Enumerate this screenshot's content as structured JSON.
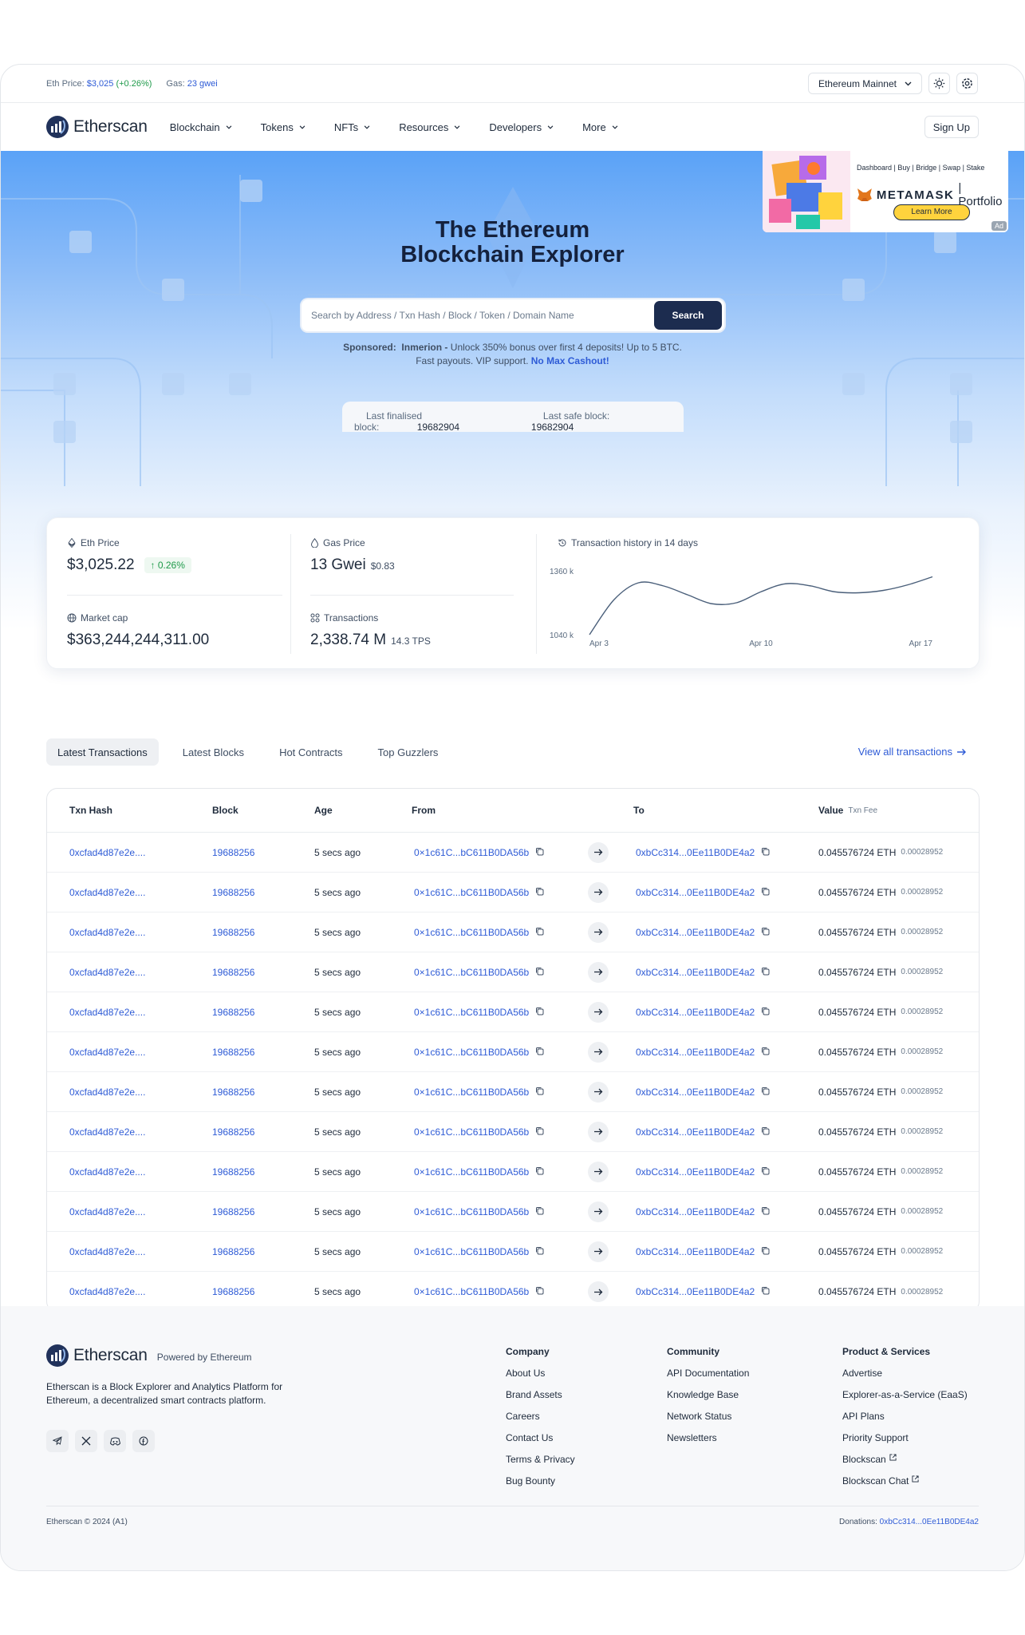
{
  "topbar": {
    "eth_price_label": "Eth Price:",
    "eth_price_value": "$3,025",
    "eth_price_change": "(+0.26%)",
    "gas_label": "Gas:",
    "gas_value": "23 gwei",
    "network": "Ethereum Mainnet"
  },
  "nav": {
    "logo": "Etherscan",
    "items": [
      "Blockchain",
      "Tokens",
      "NFTs",
      "Resources",
      "Developers",
      "More"
    ],
    "signup": "Sign Up"
  },
  "hero": {
    "title_line1": "The Ethereum",
    "title_line2": "Blockchain Explorer",
    "search_placeholder": "Search by Address / Txn Hash / Block / Token / Domain Name",
    "search_button": "Search",
    "sponsored_label": "Sponsored:",
    "sponsor_name": "Inmerion -",
    "sponsor_text1": " Unlock 350% bonus over first 4 deposits! Up to 5 BTC.",
    "sponsor_text2": "Fast payouts. VIP support. ",
    "sponsor_link": "No Max Cashout!"
  },
  "ad": {
    "menu": "Dashboard | Buy | Bridge | Swap | Stake",
    "brand": "METAMASK",
    "brand2": "| Portfolio",
    "button": "Learn More",
    "tag": "Ad"
  },
  "finality": {
    "finalised_label": "Last finalised block:",
    "finalised_value": "19682904",
    "safe_label": "Last safe block:",
    "safe_value": "19682904"
  },
  "stats": {
    "eth_price_label": "Eth Price",
    "eth_price_value": "$3,025.22",
    "eth_price_change": "0.26%",
    "market_cap_label": "Market cap",
    "market_cap_value": "$363,244,244,311.00",
    "gas_label": "Gas Price",
    "gas_value": "13 Gwei",
    "gas_usd": "$0.83",
    "tx_label": "Transactions",
    "tx_value": "2,338.74 M",
    "tx_tps": "14.3 TPS",
    "history_label": "Transaction history in 14 days"
  },
  "chart_data": {
    "type": "line",
    "x": [
      "Apr 3",
      "Apr 4",
      "Apr 5",
      "Apr 6",
      "Apr 7",
      "Apr 8",
      "Apr 9",
      "Apr 10",
      "Apr 11",
      "Apr 12",
      "Apr 13",
      "Apr 14",
      "Apr 15",
      "Apr 16",
      "Apr 17"
    ],
    "series": [
      {
        "values": [
          1040,
          1215,
          1300,
          1285,
          1240,
          1195,
          1200,
          1255,
          1295,
          1285,
          1255,
          1250,
          1262,
          1290,
          1330
        ]
      }
    ],
    "xticks": [
      "Apr 3",
      "Apr 10",
      "Apr 17"
    ],
    "yticks": [
      "1360 k",
      "1040 k"
    ],
    "ylim": [
      1040,
      1360
    ]
  },
  "tabs": [
    "Latest Transactions",
    "Latest Blocks",
    "Hot Contracts",
    "Top Guzzlers"
  ],
  "view_all": "View all transactions",
  "table": {
    "headers": {
      "hash": "Txn Hash",
      "block": "Block",
      "age": "Age",
      "from": "From",
      "to": "To",
      "value": "Value",
      "fee": "Txn Fee"
    },
    "rows": [
      {
        "hash": "0xcfad4d87e2e....",
        "block": "19688256",
        "age": "5 secs ago",
        "from": "0×1c61C...bC611B0DA56b",
        "to": "0xbCc314...0Ee11B0DE4a2",
        "value": "0.045576724 ETH",
        "fee": "0.00028952"
      },
      {
        "hash": "0xcfad4d87e2e....",
        "block": "19688256",
        "age": "5 secs ago",
        "from": "0×1c61C...bC611B0DA56b",
        "to": "0xbCc314...0Ee11B0DE4a2",
        "value": "0.045576724 ETH",
        "fee": "0.00028952"
      },
      {
        "hash": "0xcfad4d87e2e....",
        "block": "19688256",
        "age": "5 secs ago",
        "from": "0×1c61C...bC611B0DA56b",
        "to": "0xbCc314...0Ee11B0DE4a2",
        "value": "0.045576724 ETH",
        "fee": "0.00028952"
      },
      {
        "hash": "0xcfad4d87e2e....",
        "block": "19688256",
        "age": "5 secs ago",
        "from": "0×1c61C...bC611B0DA56b",
        "to": "0xbCc314...0Ee11B0DE4a2",
        "value": "0.045576724 ETH",
        "fee": "0.00028952"
      },
      {
        "hash": "0xcfad4d87e2e....",
        "block": "19688256",
        "age": "5 secs ago",
        "from": "0×1c61C...bC611B0DA56b",
        "to": "0xbCc314...0Ee11B0DE4a2",
        "value": "0.045576724 ETH",
        "fee": "0.00028952"
      },
      {
        "hash": "0xcfad4d87e2e....",
        "block": "19688256",
        "age": "5 secs ago",
        "from": "0×1c61C...bC611B0DA56b",
        "to": "0xbCc314...0Ee11B0DE4a2",
        "value": "0.045576724 ETH",
        "fee": "0.00028952"
      },
      {
        "hash": "0xcfad4d87e2e....",
        "block": "19688256",
        "age": "5 secs ago",
        "from": "0×1c61C...bC611B0DA56b",
        "to": "0xbCc314...0Ee11B0DE4a2",
        "value": "0.045576724 ETH",
        "fee": "0.00028952"
      },
      {
        "hash": "0xcfad4d87e2e....",
        "block": "19688256",
        "age": "5 secs ago",
        "from": "0×1c61C...bC611B0DA56b",
        "to": "0xbCc314...0Ee11B0DE4a2",
        "value": "0.045576724 ETH",
        "fee": "0.00028952"
      },
      {
        "hash": "0xcfad4d87e2e....",
        "block": "19688256",
        "age": "5 secs ago",
        "from": "0×1c61C...bC611B0DA56b",
        "to": "0xbCc314...0Ee11B0DE4a2",
        "value": "0.045576724 ETH",
        "fee": "0.00028952"
      },
      {
        "hash": "0xcfad4d87e2e....",
        "block": "19688256",
        "age": "5 secs ago",
        "from": "0×1c61C...bC611B0DA56b",
        "to": "0xbCc314...0Ee11B0DE4a2",
        "value": "0.045576724 ETH",
        "fee": "0.00028952"
      },
      {
        "hash": "0xcfad4d87e2e....",
        "block": "19688256",
        "age": "5 secs ago",
        "from": "0×1c61C...bC611B0DA56b",
        "to": "0xbCc314...0Ee11B0DE4a2",
        "value": "0.045576724 ETH",
        "fee": "0.00028952"
      },
      {
        "hash": "0xcfad4d87e2e....",
        "block": "19688256",
        "age": "5 secs ago",
        "from": "0×1c61C...bC611B0DA56b",
        "to": "0xbCc314...0Ee11B0DE4a2",
        "value": "0.045576724 ETH",
        "fee": "0.00028952"
      }
    ]
  },
  "footer": {
    "logo": "Etherscan",
    "powered": "Powered by Ethereum",
    "description": "Etherscan is a Block Explorer and Analytics Platform for Ethereum, a decentralized smart contracts platform.",
    "socials": [
      "telegram-icon",
      "x-icon",
      "discord-icon",
      "facebook-icon"
    ],
    "company": {
      "title": "Company",
      "items": [
        "About Us",
        "Brand Assets",
        "Careers",
        "Contact Us",
        "Terms & Privacy",
        "Bug Bounty"
      ]
    },
    "community": {
      "title": "Community",
      "items": [
        "API Documentation",
        "Knowledge Base",
        "Network Status",
        "Newsletters"
      ]
    },
    "products": {
      "title": "Product & Services",
      "items": [
        "Advertise",
        "Explorer-as-a-Service (EaaS)",
        "API Plans",
        "Priority Support",
        "Blockscan",
        "Blockscan Chat"
      ]
    },
    "copyright": "Etherscan © 2024 (A1)",
    "donations_label": "Donations:",
    "donations_address": "0xbCc314...0Ee11B0DE4a2"
  },
  "colors": {
    "accent": "#2e5bd6",
    "button_dark": "#1c2c4f",
    "positive": "#1f9a4a"
  }
}
